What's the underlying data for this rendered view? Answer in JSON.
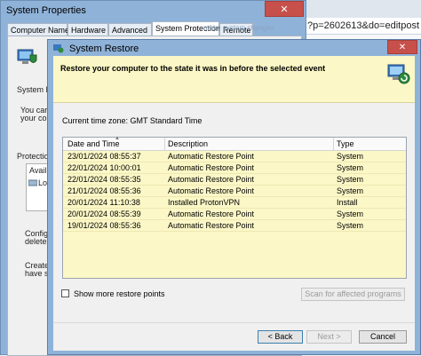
{
  "browser": {
    "address_fragment": "?p=2602613&do=editpost"
  },
  "system_properties": {
    "title": "System Properties",
    "close_glyph": "✕",
    "tabs": [
      "Computer Name",
      "Hardware",
      "Advanced",
      "System Protection",
      "Remote"
    ],
    "active_tab": "System Protection",
    "visible_text": {
      "system_restore_fragment": "System R",
      "you_can_line1": "You car",
      "you_can_line2": "your co",
      "protection_fragment": "Protectio",
      "avail_fragment": "Avail",
      "lo_fragment": "Lo",
      "config_line1": "Config",
      "config_line2": "delete",
      "create_line1": "Create",
      "create_line2": "have s",
      "tab_strip_fragment": "make system changes."
    }
  },
  "restore_dialog": {
    "title": "System Restore",
    "close_glyph": "✕",
    "heading": "Restore your computer to the state it was in before the selected event",
    "timezone": "Current time zone: GMT Standard Time",
    "columns": [
      "Date and Time",
      "Description",
      "Type"
    ],
    "rows": [
      {
        "date": "23/01/2024 08:55:37",
        "description": "Automatic Restore Point",
        "type": "System"
      },
      {
        "date": "22/01/2024 10:00:01",
        "description": "Automatic Restore Point",
        "type": "System"
      },
      {
        "date": "22/01/2024 08:55:35",
        "description": "Automatic Restore Point",
        "type": "System"
      },
      {
        "date": "21/01/2024 08:55:36",
        "description": "Automatic Restore Point",
        "type": "System"
      },
      {
        "date": "20/01/2024 11:10:38",
        "description": "Installed ProtonVPN",
        "type": "Install"
      },
      {
        "date": "20/01/2024 08:55:39",
        "description": "Automatic Restore Point",
        "type": "System"
      },
      {
        "date": "19/01/2024 08:55:36",
        "description": "Automatic Restore Point",
        "type": "System"
      }
    ],
    "show_more_label": "Show more restore points",
    "scan_button": "Scan for affected programs",
    "back_button": "< Back",
    "next_button": "Next >",
    "cancel_button": "Cancel"
  },
  "icons": [
    "computer-shield-icon",
    "restore-icon",
    "drive-icon"
  ],
  "colors": {
    "header_band": "#fbf7c6",
    "titlebar": "#8fb2d8",
    "close_button": "#c7504b"
  }
}
